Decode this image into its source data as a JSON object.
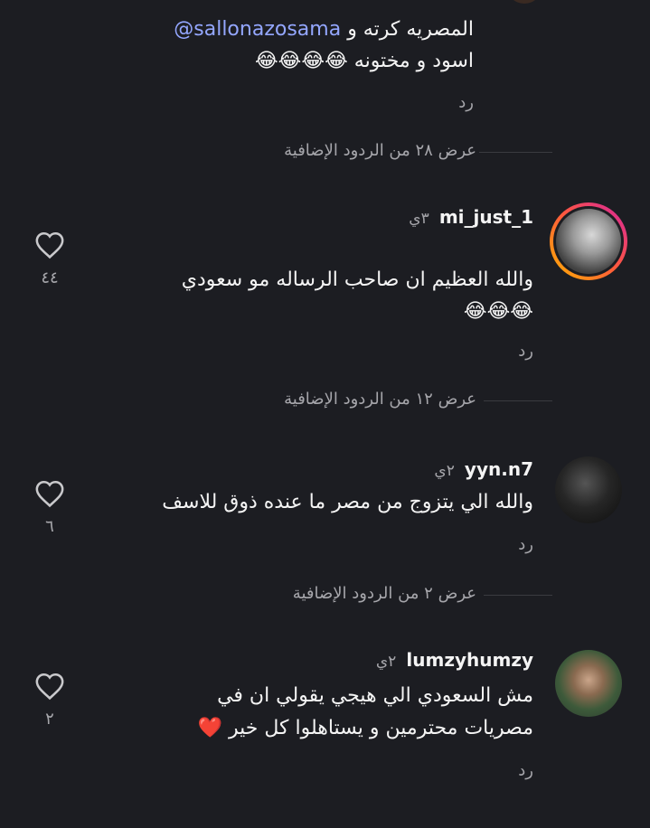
{
  "comment0": {
    "line1_mention": "sallonazosama@",
    "line1_text": "المصريه كرته و",
    "line2": "اسود و مختونه 😂😂😂😂",
    "reply": "رد",
    "view_more": "عرض ٢٨ من الردود الإضافية"
  },
  "comment1": {
    "username": "mi_just_1",
    "time": "٣ي",
    "line1": "والله العظيم ان صاحب الرساله مو سعودي",
    "line2": "😂😂😂",
    "reply": "رد",
    "likes": "٤٤",
    "view_more": "عرض ١٢ من الردود الإضافية"
  },
  "comment2": {
    "username": "yyn.n7",
    "time": "٢ي",
    "line1": "والله الي يتزوج من مصر ما عنده ذوق للاسف",
    "reply": "رد",
    "likes": "٦",
    "view_more": "عرض ٢ من الردود الإضافية"
  },
  "comment3": {
    "username": "lumzyhumzy",
    "time": "٢ي",
    "line1": "مش السعودي الي هيجي يقولي ان في",
    "line2": "مصريات محترمين و يستاهلوا كل خير ❤️",
    "reply": "رد",
    "likes": "٢"
  },
  "colors": {
    "background": "#1c1d22",
    "mention": "#94a7ff",
    "muted": "#a6a6ab",
    "story_ring_start": "#ffb300",
    "story_ring_end": "#d6249f"
  }
}
